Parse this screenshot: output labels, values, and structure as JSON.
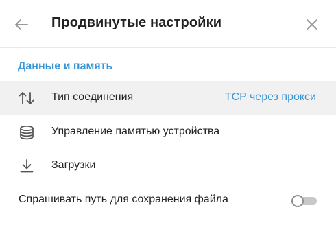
{
  "header": {
    "title": "Продвинутые настройки",
    "back_icon": "arrow-left-icon",
    "close_icon": "close-icon"
  },
  "section": {
    "title": "Данные и память"
  },
  "rows": [
    {
      "label": "Тип соединения",
      "value": "TCP через прокси",
      "icon": "sort-arrows-icon",
      "highlighted": true
    },
    {
      "label": "Управление памятью устройства",
      "icon": "database-icon"
    },
    {
      "label": "Загрузки",
      "icon": "download-icon"
    }
  ],
  "toggle_row": {
    "label": "Спрашивать путь для сохранения файла",
    "enabled": false
  },
  "colors": {
    "accent": "#3a95d5",
    "text": "#222222",
    "icon": "#8e8e8e",
    "hover_bg": "#f1f1f1",
    "divider": "#e9e9e9"
  }
}
